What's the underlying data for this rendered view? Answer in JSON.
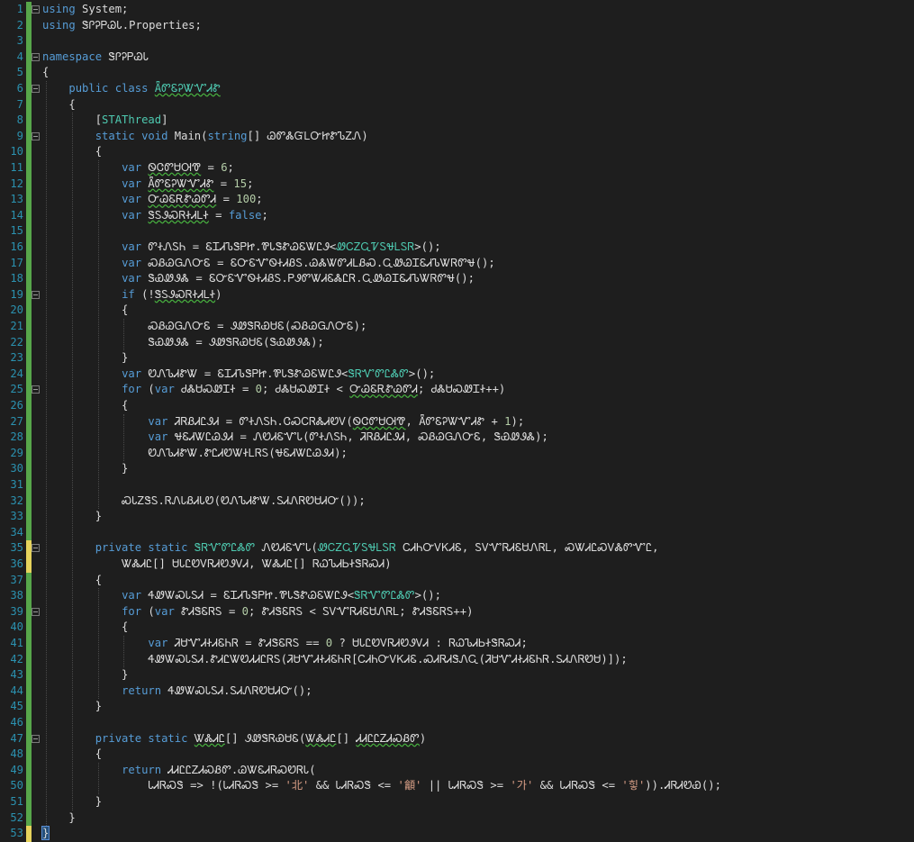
{
  "editor": {
    "lines": [
      {
        "n": "1",
        "segs": [
          {
            "t": "using",
            "c": "kw"
          },
          {
            "t": " System;"
          }
        ]
      },
      {
        "n": "2",
        "segs": [
          {
            "t": "using",
            "c": "kw"
          },
          {
            "t": " ᏕᎵᎮᏢᏊᏓ.Properties;"
          }
        ]
      },
      {
        "n": "3",
        "segs": []
      },
      {
        "n": "4",
        "segs": [
          {
            "t": "namespace",
            "c": "kw"
          },
          {
            "t": " ᏕᎵᎮᏢᏊᏓ"
          }
        ]
      },
      {
        "n": "5",
        "segs": [
          {
            "t": "{"
          }
        ]
      },
      {
        "n": "6",
        "segs": [
          {
            "t": "    "
          },
          {
            "t": "public",
            "c": "kw"
          },
          {
            "t": " "
          },
          {
            "t": "class",
            "c": "kw"
          },
          {
            "t": " "
          },
          {
            "t": "ǞᏛᏋᎮᏔᏉᏗᏑ",
            "c": "ty sq"
          }
        ]
      },
      {
        "n": "7",
        "segs": [
          {
            "t": "    {"
          }
        ]
      },
      {
        "n": "8",
        "segs": [
          {
            "t": "        ["
          },
          {
            "t": "STAThread",
            "c": "at"
          },
          {
            "t": "]"
          }
        ]
      },
      {
        "n": "9",
        "segs": [
          {
            "t": "        "
          },
          {
            "t": "static",
            "c": "kw"
          },
          {
            "t": " "
          },
          {
            "t": "void",
            "c": "kw"
          },
          {
            "t": " Main("
          },
          {
            "t": "string",
            "c": "kw"
          },
          {
            "t": "[] ᏊᏛᏜᏳᏞᏅᏥᏑᏖᏃᏁ)"
          }
        ]
      },
      {
        "n": "10",
        "segs": [
          {
            "t": "        {"
          }
        ]
      },
      {
        "n": "11",
        "segs": [
          {
            "t": "            "
          },
          {
            "t": "var",
            "c": "kw"
          },
          {
            "t": " "
          },
          {
            "t": "ᏫᏣᏛᏌᎺᏡ",
            "c": "sq"
          },
          {
            "t": " = "
          },
          {
            "t": "6",
            "c": "nm"
          },
          {
            "t": ";"
          }
        ]
      },
      {
        "n": "12",
        "segs": [
          {
            "t": "            "
          },
          {
            "t": "var",
            "c": "kw"
          },
          {
            "t": " "
          },
          {
            "t": "ǞᏛᏋᎮᏔᏉᏗᏑ",
            "c": "sq"
          },
          {
            "t": " = "
          },
          {
            "t": "15",
            "c": "nm"
          },
          {
            "t": ";"
          }
        ]
      },
      {
        "n": "13",
        "segs": [
          {
            "t": "            "
          },
          {
            "t": "var",
            "c": "kw"
          },
          {
            "t": " "
          },
          {
            "t": "ᏅᏊᏋᎡᏑᏊᏛᏗ",
            "c": "sq"
          },
          {
            "t": " = "
          },
          {
            "t": "100",
            "c": "nm"
          },
          {
            "t": ";"
          }
        ]
      },
      {
        "n": "14",
        "segs": [
          {
            "t": "            "
          },
          {
            "t": "var",
            "c": "kw"
          },
          {
            "t": " "
          },
          {
            "t": "ᏕᏚᏭᏍᏒᏐᏗᏞᏐ",
            "c": "sq"
          },
          {
            "t": " = "
          },
          {
            "t": "false",
            "c": "kw"
          },
          {
            "t": ";"
          }
        ]
      },
      {
        "n": "15",
        "segs": []
      },
      {
        "n": "16",
        "segs": [
          {
            "t": "            "
          },
          {
            "t": "var",
            "c": "kw"
          },
          {
            "t": " ᏛᏐᏁᏚᏂ = ᏋᏆᏗᏖᏕᏢᏥ.ᏈᏓᏕᏑᏊᏋᏔᏝᏭ<"
          },
          {
            "t": "ᏪᏟᏃᏩᏤᏚᏠᏞᏚᏒ",
            "c": "ty"
          },
          {
            "t": ">();"
          }
        ]
      },
      {
        "n": "17",
        "segs": [
          {
            "t": "            "
          },
          {
            "t": "var",
            "c": "kw"
          },
          {
            "t": " ᏍᏰᏊᏀᏁᏅᏋ = ᏋᏅᏋᏉᏫᏐᏗᏰᏚ.ᏊᏜᏔᏛᏗᏞᏰᏍ.ᏩᏪᏊᏆᏋᏗᏖᏔᏒᏛᏠ();"
          }
        ]
      },
      {
        "n": "18",
        "segs": [
          {
            "t": "            "
          },
          {
            "t": "var",
            "c": "kw"
          },
          {
            "t": " ᏕᏯᏪᏭᏜ = ᏋᏅᏋᏉᏫᏐᏗᏰᏚ.ᏢᏭᏛᏔᏗᏋᏜᏝᏒ.ᏩᏪᏊᏆᏋᏗᏖᏔᏒᏛᏠ();"
          }
        ]
      },
      {
        "n": "19",
        "segs": [
          {
            "t": "            "
          },
          {
            "t": "if",
            "c": "kw"
          },
          {
            "t": " (!"
          },
          {
            "t": "ᏕᏚᏭᏍᏒᏐᏗᏞᏐ",
            "c": "sq"
          },
          {
            "t": ")"
          }
        ]
      },
      {
        "n": "20",
        "segs": [
          {
            "t": "            {"
          }
        ]
      },
      {
        "n": "21",
        "segs": [
          {
            "t": "                ᏍᏰᏊᏀᏁᏅᏋ = ᏭᏪᏕᏒᏯᏌᏋ(ᏍᏰᏊᏀᏁᏅᏋ);"
          }
        ]
      },
      {
        "n": "22",
        "segs": [
          {
            "t": "                ᏕᏯᏪᏭᏜ = ᏭᏪᏕᏒᏯᏌᏋ(ᏕᏯᏪᏭᏜ);"
          }
        ]
      },
      {
        "n": "23",
        "segs": [
          {
            "t": "            }"
          }
        ]
      },
      {
        "n": "24",
        "segs": [
          {
            "t": "            "
          },
          {
            "t": "var",
            "c": "kw"
          },
          {
            "t": " ᏬᏁᏖᏗᏑᏔ = ᏋᏆᏗᏖᏕᏢᏥ.ᏈᏓᏕᏑᏊᏋᏔᏝᏭ<"
          },
          {
            "t": "ᏕᏒᏉᏛᏝᏜᏛ",
            "c": "ty"
          },
          {
            "t": ">();"
          }
        ]
      },
      {
        "n": "25",
        "segs": [
          {
            "t": "            "
          },
          {
            "t": "for",
            "c": "kw"
          },
          {
            "t": " ("
          },
          {
            "t": "var",
            "c": "kw"
          },
          {
            "t": " ᏧᏜᏌᏍᏪᏆᏐ = "
          },
          {
            "t": "0",
            "c": "nm"
          },
          {
            "t": "; ᏧᏜᏌᏍᏪᏆᏐ < "
          },
          {
            "t": "ᏅᏊᏋᎡᏑᏊᏛᏗ",
            "c": "sq"
          },
          {
            "t": "; ᏧᏜᏌᏍᏪᏆᏐ++)"
          }
        ]
      },
      {
        "n": "26",
        "segs": [
          {
            "t": "            {"
          }
        ]
      },
      {
        "n": "27",
        "segs": [
          {
            "t": "                "
          },
          {
            "t": "var",
            "c": "kw"
          },
          {
            "t": " ᏘᏒᏰᏗᏝᏭᏗ = ᏛᏐᏁᏚᏂ.ᏣᏍᏟᏒᏜᏗᏬᏙ("
          },
          {
            "t": "ᏫᏣᏛᏌᎺᏡ",
            "c": "sq"
          },
          {
            "t": ", ǞᏛᏋᎮᏔᏉᏗᏑ + "
          },
          {
            "t": "1",
            "c": "nm"
          },
          {
            "t": ");"
          }
        ]
      },
      {
        "n": "28",
        "segs": [
          {
            "t": "                "
          },
          {
            "t": "var",
            "c": "kw"
          },
          {
            "t": " ᏠᏋᏗᏔᏝᏊᏭᏗ = ᏁᏬᏗᏋᏉᏓ(ᏛᏐᏁᏚᏂ, ᏘᏒᏰᏗᏝᏭᏗ, ᏍᏰᏊᏀᏁᏅᏋ, ᏕᏯᏪᏭᏜ);"
          }
        ]
      },
      {
        "n": "29",
        "segs": [
          {
            "t": "                ᏬᏁᏖᏗᏑᏔ.ᏑᏝᏗᏬᏔᏐᏞᏒᏚ(ᏠᏋᏗᏔᏝᏊᏭᏗ);"
          }
        ]
      },
      {
        "n": "30",
        "segs": [
          {
            "t": "            }"
          }
        ]
      },
      {
        "n": "31",
        "segs": []
      },
      {
        "n": "32",
        "segs": [
          {
            "t": "            ᏍᏓᏃᏕᏚ.ᏒᏁᏓᏰᏗᏓᏬ(ᏬᏁᏖᏗᏑᏔ.ᏚᏗᏁᏒᏬᏌᏗᏅ());"
          }
        ]
      },
      {
        "n": "33",
        "segs": [
          {
            "t": "        }"
          }
        ]
      },
      {
        "n": "34",
        "segs": []
      },
      {
        "n": "35",
        "segs": [
          {
            "t": "        "
          },
          {
            "t": "private",
            "c": "kw"
          },
          {
            "t": " "
          },
          {
            "t": "static",
            "c": "kw"
          },
          {
            "t": " "
          },
          {
            "t": "ᏕᏒᏉᏛᏝᏜᏛ",
            "c": "ty"
          },
          {
            "t": " ᏁᏬᏗᏋᏉᏓ("
          },
          {
            "t": "ᏪᏟᏃᏩᏤᏚᏠᏞᏚᏒ",
            "c": "ty"
          },
          {
            "t": " ᏟᏗᏂᏅᏙᏦᏗᏋ, ᏚᏙᏉᏒᏗᏋᏌᏁᏒᏞ, ᏍᏔᏗᏝᏍᏙᏜᏛᏉᏝ,"
          }
        ]
      },
      {
        "n": "36",
        "segs": [
          {
            "t": "            ᏔᏜᏗᏝ[] ᏌᏓᏝᏬᏙᏒᏗᏬᏭᏙᏗ, ᏔᏜᏗᏝ[] ᏒᏇᏖᏗᏏᏐᏕᏒᏍᏗ)"
          }
        ]
      },
      {
        "n": "37",
        "segs": [
          {
            "t": "        {"
          }
        ]
      },
      {
        "n": "38",
        "segs": [
          {
            "t": "            "
          },
          {
            "t": "var",
            "c": "kw"
          },
          {
            "t": " ᏎᏪᏔᏍᏓᏚᏗ = ᏋᏆᏗᏖᏕᏢᏥ.ᏈᏓᏕᏑᏊᏋᏔᏝᏭ<"
          },
          {
            "t": "ᏕᏒᏉᏛᏝᏜᏛ",
            "c": "ty"
          },
          {
            "t": ">();"
          }
        ]
      },
      {
        "n": "39",
        "segs": [
          {
            "t": "            "
          },
          {
            "t": "for",
            "c": "kw"
          },
          {
            "t": " ("
          },
          {
            "t": "var",
            "c": "kw"
          },
          {
            "t": " ᏑᏗᏕᏋᏒᏚ = "
          },
          {
            "t": "0",
            "c": "nm"
          },
          {
            "t": "; ᏑᏗᏕᏋᏒᏚ < ᏚᏙᏉᏒᏗᏋᏌᏁᏒᏞ; ᏑᏗᏕᏋᏒᏚ++)"
          }
        ]
      },
      {
        "n": "40",
        "segs": [
          {
            "t": "            {"
          }
        ]
      },
      {
        "n": "41",
        "segs": [
          {
            "t": "                "
          },
          {
            "t": "var",
            "c": "kw"
          },
          {
            "t": " ᏘᏌᏉᏗᏐᏗᏋᏂᏒ = ᏑᏗᏕᏋᏒᏚ == "
          },
          {
            "t": "0",
            "c": "nm"
          },
          {
            "t": " ? ᏌᏓᏝᏬᏙᏒᏗᏬᏭᏙᏗ : ᏒᏇᏖᏗᏏᏐᏕᏒᏍᏗ;"
          }
        ]
      },
      {
        "n": "42",
        "segs": [
          {
            "t": "                ᏎᏪᏔᏍᏓᏚᏗ.ᏑᏗᏝᏔᏬᏗᏗᏝᏒᏚ(ᏘᏌᏉᏗᏐᏗᏋᏂᏒ[ᏟᏗᏂᏅᏙᏦᏗᏋ.ᏍᏗᏒᏗᏕᏁᏩ(ᏘᏌᏉᏗᏐᏗᏋᏂᏒ.ᏚᏗᏁᏒᏬᏌ)]);"
          }
        ]
      },
      {
        "n": "43",
        "segs": [
          {
            "t": "            }"
          }
        ]
      },
      {
        "n": "44",
        "segs": [
          {
            "t": "            "
          },
          {
            "t": "return",
            "c": "kw"
          },
          {
            "t": " ᏎᏪᏔᏍᏓᏚᏗ.ᏚᏗᏁᏒᏬᏌᏗᏅ();"
          }
        ]
      },
      {
        "n": "45",
        "segs": [
          {
            "t": "        }"
          }
        ]
      },
      {
        "n": "46",
        "segs": []
      },
      {
        "n": "47",
        "segs": [
          {
            "t": "        "
          },
          {
            "t": "private",
            "c": "kw"
          },
          {
            "t": " "
          },
          {
            "t": "static",
            "c": "kw"
          },
          {
            "t": " "
          },
          {
            "t": "ᏔᏜᏗᏝ",
            "c": "sq"
          },
          {
            "t": "[] ᏭᏪᏕᏒᏯᏌᏋ("
          },
          {
            "t": "ᏔᏜᏗᏝ",
            "c": "sq"
          },
          {
            "t": "[] "
          },
          {
            "t": "ᏗᏗᏝᏝᏃᏗᏍᏰᏛ",
            "c": "sq"
          },
          {
            "t": ")"
          }
        ]
      },
      {
        "n": "48",
        "segs": [
          {
            "t": "        {"
          }
        ]
      },
      {
        "n": "49",
        "segs": [
          {
            "t": "            "
          },
          {
            "t": "return",
            "c": "kw"
          },
          {
            "t": " ᏗᏗᏝᏝᏃᏗᏍᏰᏛ.ᏊᏔᏋᏗᏒᏍᏬᏒᏓ("
          }
        ]
      },
      {
        "n": "50",
        "segs": [
          {
            "t": "                ᏓᏗᏒᏍᏕ => !(ᏓᏗᏒᏍᏕ >= "
          },
          {
            "t": "'北'",
            "c": "st"
          },
          {
            "t": " && ᏓᏗᏒᏍᏕ <= "
          },
          {
            "t": "'龥'",
            "c": "st"
          },
          {
            "t": " || ᏓᏗᏒᏍᏕ >= "
          },
          {
            "t": "'가'",
            "c": "st"
          },
          {
            "t": " && ᏓᏗᏒᏍᏕ <= "
          },
          {
            "t": "'힣'",
            "c": "st"
          },
          {
            "t": ")).ᏗᏒᏗᏬᏯ();"
          }
        ]
      },
      {
        "n": "51",
        "segs": [
          {
            "t": "        }"
          }
        ]
      },
      {
        "n": "52",
        "segs": [
          {
            "t": "    }"
          }
        ]
      },
      {
        "n": "53",
        "segs": [
          {
            "t": "}",
            "c": "cur"
          }
        ]
      }
    ],
    "colors": {
      "background": "#1e1e1e",
      "keyword": "#569cd6",
      "type": "#4ec9b0",
      "string": "#d69d85",
      "number": "#b5cea8",
      "lineNumber": "#2b91af",
      "changeBar": "#57a64a"
    }
  }
}
